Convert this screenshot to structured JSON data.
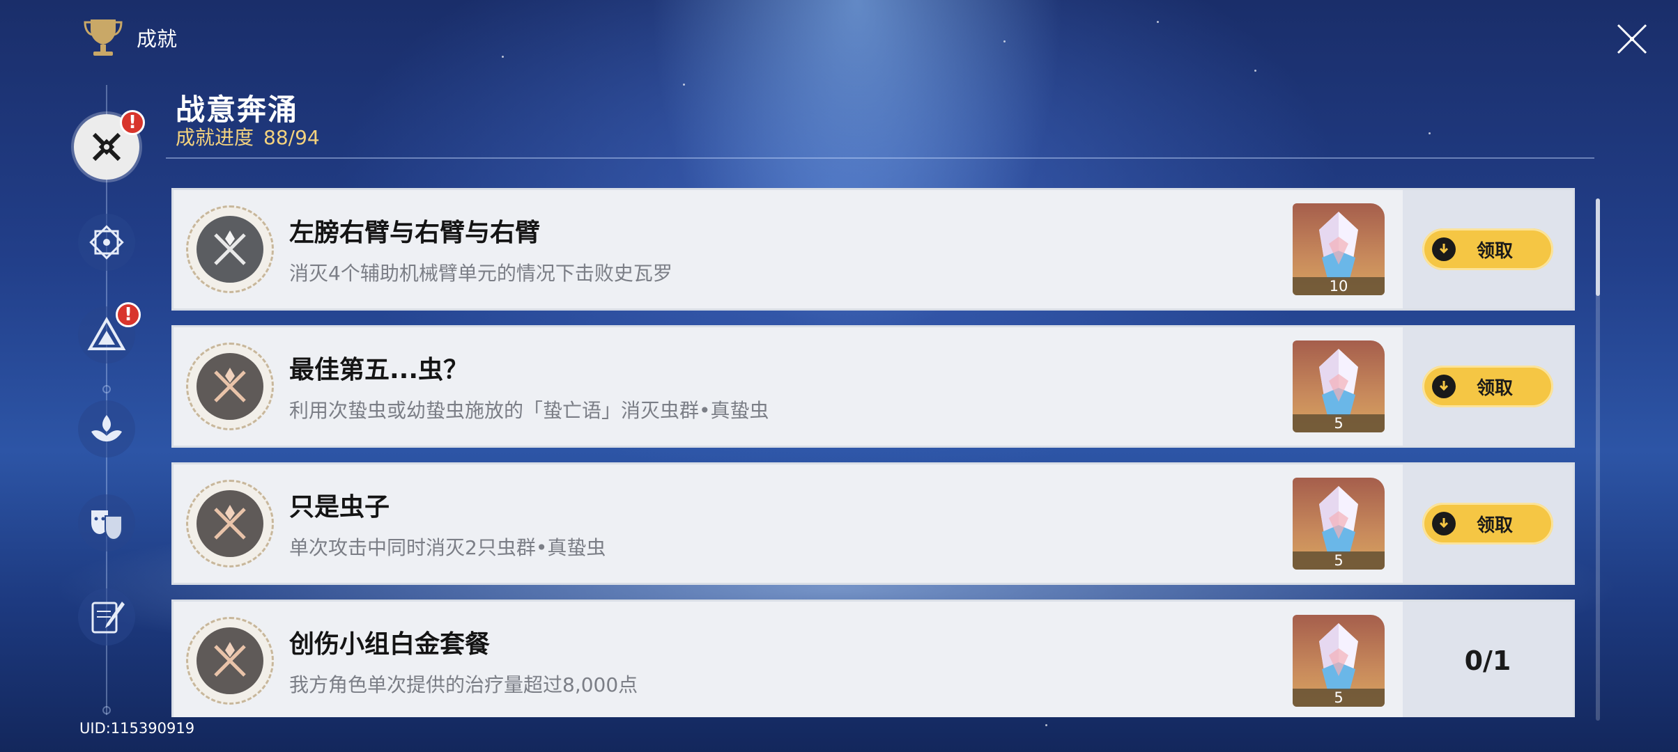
{
  "header": {
    "title": "成就",
    "trophy_icon": "trophy-icon",
    "close_icon": "close-icon"
  },
  "sidebar": {
    "items": [
      {
        "icon": "battle-crossed-swords-icon",
        "active": true,
        "alert": "!"
      },
      {
        "icon": "geometric-frame-icon",
        "active": false,
        "alert": null
      },
      {
        "icon": "triangle-emblem-icon",
        "active": false,
        "alert": "!"
      },
      {
        "icon": "cloud-lotus-icon",
        "active": false,
        "alert": null
      },
      {
        "icon": "theatre-masks-icon",
        "active": false,
        "alert": null
      },
      {
        "icon": "notebook-quill-icon",
        "active": false,
        "alert": null
      }
    ]
  },
  "category": {
    "title": "战意奔涌",
    "progress_label": "成就进度",
    "progress_value": "88/94"
  },
  "achievements": [
    {
      "name": "左膀右臂与右臂与右臂",
      "desc": "消灭4个辅助机械臂单元的情况下击败史瓦罗",
      "reward_qty": "10",
      "state": "claim",
      "claim_label": "领取",
      "badge_tier": "silver"
    },
    {
      "name": "最佳第五...虫？",
      "desc": "利用次蛰虫或幼蛰虫施放的「蛰亡语」消灭虫群•真蛰虫",
      "reward_qty": "5",
      "state": "claim",
      "claim_label": "领取",
      "badge_tier": "bronze"
    },
    {
      "name": "只是虫子",
      "desc": "单次攻击中同时消灭2只虫群•真蛰虫",
      "reward_qty": "5",
      "state": "claim",
      "claim_label": "领取",
      "badge_tier": "bronze"
    },
    {
      "name": "创伤小组白金套餐",
      "desc": "我方角色单次提供的治疗量超过8,000点",
      "reward_qty": "5",
      "state": "progress",
      "progress": "0/1",
      "badge_tier": "bronze"
    }
  ],
  "footer": {
    "uid": "UID:115390919"
  },
  "colors": {
    "claim_button": "#f5c644",
    "progress_text": "#f3d27e",
    "alert": "#d8352c"
  }
}
